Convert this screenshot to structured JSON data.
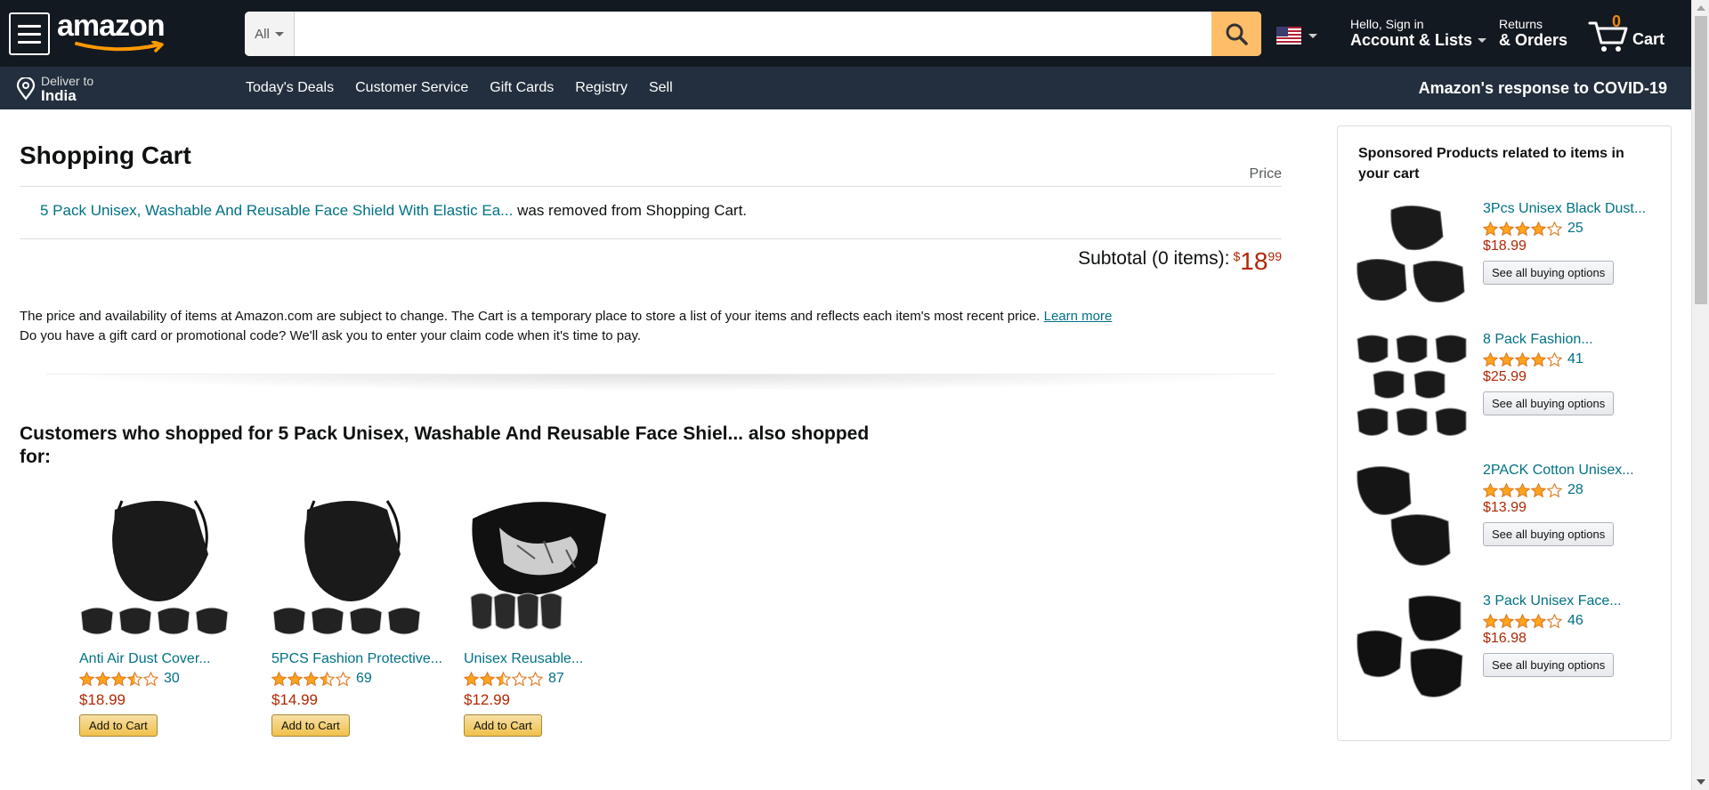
{
  "nav": {
    "logo_text": "amazon",
    "search": {
      "category": "All",
      "placeholder": ""
    },
    "account": {
      "greeting": "Hello, Sign in",
      "label": "Account & Lists"
    },
    "returns": {
      "line1": "Returns",
      "line2": "& Orders"
    },
    "cart": {
      "count": "0",
      "label": "Cart"
    }
  },
  "subnav": {
    "deliver_to": "Deliver to",
    "location": "India",
    "links": [
      "Today's Deals",
      "Customer Service",
      "Gift Cards",
      "Registry",
      "Sell"
    ],
    "covid": "Amazon's response to COVID-19"
  },
  "cart": {
    "title": "Shopping Cart",
    "price_header": "Price",
    "removed_item": "5 Pack Unisex, Washable And Reusable Face Shield With Elastic Ea...",
    "removed_suffix": " was removed from Shopping Cart.",
    "subtotal_label": "Subtotal (0 items):",
    "subtotal_symbol": "$",
    "subtotal_whole": "18",
    "subtotal_fraction": "99",
    "disclaimer": "The price and availability of items at Amazon.com are subject to change. The Cart is a temporary place to store a list of your items and reflects each item's most recent price.",
    "learn_more": "Learn more",
    "gift_card_note": "Do you have a gift card or promotional code? We'll ask you to enter your claim code when it's time to pay."
  },
  "also_shopped": {
    "title": "Customers who shopped for 5 Pack Unisex, Washable And Reusable Face Shiel... also shopped for:",
    "add_to_cart_label": "Add to Cart",
    "items": [
      {
        "title": "Anti Air Dust Cover...",
        "rating": 3.5,
        "reviews": "30",
        "price": "$18.99"
      },
      {
        "title": "5PCS Fashion Protective...",
        "rating": 3.5,
        "reviews": "69",
        "price": "$14.99"
      },
      {
        "title": "Unisex Reusable...",
        "rating": 2.5,
        "reviews": "87",
        "price": "$12.99"
      }
    ]
  },
  "sponsored": {
    "title": "Sponsored Products related to items in your cart",
    "button_label": "See all buying options",
    "items": [
      {
        "title": "3Pcs Unisex Black Dust...",
        "rating": 4,
        "reviews": "25",
        "price": "$18.99"
      },
      {
        "title": "8 Pack Fashion...",
        "rating": 4,
        "reviews": "41",
        "price": "$25.99"
      },
      {
        "title": "2PACK Cotton Unisex...",
        "rating": 4,
        "reviews": "28",
        "price": "$13.99"
      },
      {
        "title": "3 Pack Unisex Face...",
        "rating": 4,
        "reviews": "46",
        "price": "$16.98"
      }
    ]
  },
  "colors": {
    "nav_dark": "#131921",
    "nav_sub": "#232F3E",
    "link": "#007185",
    "price": "#B12704",
    "star": "#FFA41C",
    "search_btn": "#FEBD69"
  }
}
